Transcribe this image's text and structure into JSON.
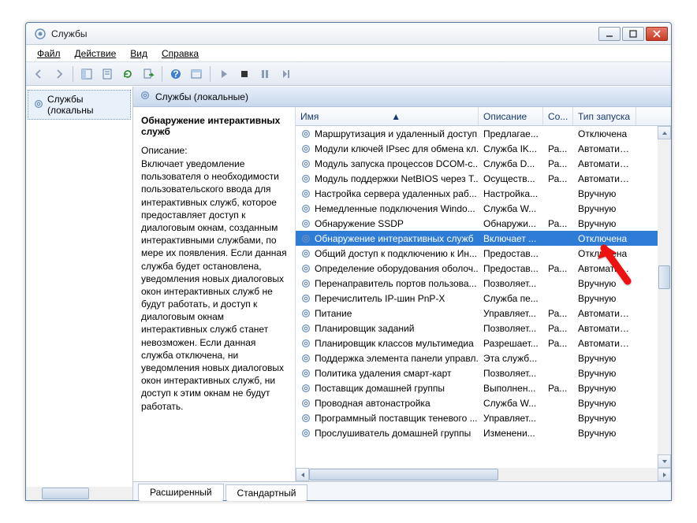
{
  "title": "Службы",
  "menu": {
    "file": "Файл",
    "action": "Действие",
    "view": "Вид",
    "help": "Справка"
  },
  "tree": {
    "root": "Службы (локальны"
  },
  "panel_header": "Службы (локальные)",
  "detail": {
    "name": "Обнаружение интерактивных служб",
    "desc_label": "Описание:",
    "desc": "Включает уведомление пользователя о необходимости пользовательского ввода для интерактивных служб, которое предоставляет доступ к диалоговым окнам, созданным интерактивными службами, по мере их появления. Если данная служба будет остановлена, уведомления новых диалоговых окон интерактивных служб не будут работать, и доступ к диалоговым окнам интерактивных служб станет невозможен. Если данная служба отключена, ни уведомления новых диалоговых окон интерактивных служб, ни доступ к этим окнам не будут работать."
  },
  "columns": {
    "name": "Имя",
    "desc": "Описание",
    "state": "Со...",
    "start": "Тип запуска"
  },
  "rows": [
    {
      "name": "Маршрутизация и удаленный доступ",
      "desc": "Предлагае...",
      "state": "",
      "start": "Отключена"
    },
    {
      "name": "Модули ключей IPsec для обмена кл...",
      "desc": "Служба IK...",
      "state": "Ра...",
      "start": "Автоматиче..."
    },
    {
      "name": "Модуль запуска процессов DCOM-с...",
      "desc": "Служба D...",
      "state": "Ра...",
      "start": "Автоматиче..."
    },
    {
      "name": "Модуль поддержки NetBIOS через T...",
      "desc": "Осуществ...",
      "state": "Ра...",
      "start": "Автоматиче..."
    },
    {
      "name": "Настройка сервера удаленных раб...",
      "desc": "Настройка...",
      "state": "",
      "start": "Вручную"
    },
    {
      "name": "Немедленные подключения Windo...",
      "desc": "Служба W...",
      "state": "",
      "start": "Вручную"
    },
    {
      "name": "Обнаружение SSDP",
      "desc": "Обнаружи...",
      "state": "Ра...",
      "start": "Вручную"
    },
    {
      "name": "Обнаружение интерактивных служб",
      "desc": "Включает ...",
      "state": "",
      "start": "Отключена",
      "selected": true
    },
    {
      "name": "Общий доступ к подключению к Ин...",
      "desc": "Предостав...",
      "state": "",
      "start": "Отключена"
    },
    {
      "name": "Определение оборудования оболоч...",
      "desc": "Предостав...",
      "state": "Ра...",
      "start": "Автоматиче..."
    },
    {
      "name": "Перенаправитель портов пользова...",
      "desc": "Позволяет...",
      "state": "",
      "start": "Вручную"
    },
    {
      "name": "Перечислитель IP-шин PnP-X",
      "desc": "Служба пе...",
      "state": "",
      "start": "Вручную"
    },
    {
      "name": "Питание",
      "desc": "Управляет...",
      "state": "Ра...",
      "start": "Автоматиче..."
    },
    {
      "name": "Планировщик заданий",
      "desc": "Позволяет...",
      "state": "Ра...",
      "start": "Автоматиче..."
    },
    {
      "name": "Планировщик классов мультимедиа",
      "desc": "Разрешает...",
      "state": "Ра...",
      "start": "Автоматиче..."
    },
    {
      "name": "Поддержка элемента панели управл...",
      "desc": "Эта служб...",
      "state": "",
      "start": "Вручную"
    },
    {
      "name": "Политика удаления смарт-карт",
      "desc": "Позволяет...",
      "state": "",
      "start": "Вручную"
    },
    {
      "name": "Поставщик домашней группы",
      "desc": "Выполнен...",
      "state": "Ра...",
      "start": "Вручную"
    },
    {
      "name": "Проводная автонастройка",
      "desc": "Служба W...",
      "state": "",
      "start": "Вручную"
    },
    {
      "name": "Программный поставщик теневого ...",
      "desc": "Управляет...",
      "state": "",
      "start": "Вручную"
    },
    {
      "name": "Прослушиватель домашней группы",
      "desc": "Изменени...",
      "state": "",
      "start": "Вручную"
    }
  ],
  "tabs": {
    "extended": "Расширенный",
    "standard": "Стандартный"
  }
}
